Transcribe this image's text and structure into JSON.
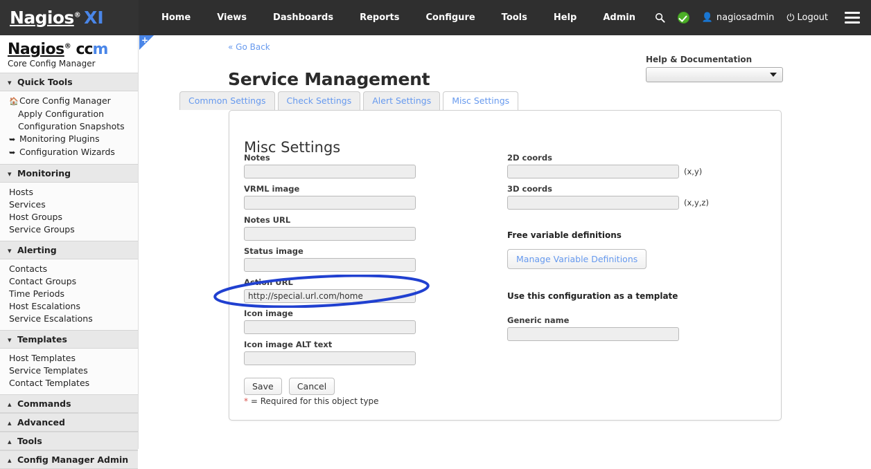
{
  "topbar": {
    "logo": {
      "name": "Nagios",
      "reg": "®",
      "product": "XI"
    },
    "nav": [
      {
        "label": "Home"
      },
      {
        "label": "Views"
      },
      {
        "label": "Dashboards"
      },
      {
        "label": "Reports"
      },
      {
        "label": "Configure"
      },
      {
        "label": "Tools"
      },
      {
        "label": "Help"
      },
      {
        "label": "Admin"
      }
    ],
    "right": {
      "search_icon": "search-icon",
      "status_icon": "green-check-icon",
      "user_icon": "person-icon",
      "username": "nagiosadmin",
      "power_icon": "power-icon",
      "logout": "Logout",
      "menu_icon": "hamburger-icon"
    }
  },
  "sidebar": {
    "brand": {
      "name": "Nagios",
      "reg": "®",
      "cc": "cc",
      "m": "m",
      "subtitle": "Core Config Manager"
    },
    "sections": [
      {
        "title": "Quick Tools",
        "collapsed": false,
        "chevron": "chevron-down-icon",
        "items": [
          {
            "label": "Core Config Manager",
            "icon": "home-icon"
          },
          {
            "label": "Apply Configuration",
            "icon": ""
          },
          {
            "label": "Configuration Snapshots",
            "icon": ""
          },
          {
            "label": "Monitoring Plugins",
            "icon": "arrow-right-icon"
          },
          {
            "label": "Configuration Wizards",
            "icon": "arrow-right-icon"
          }
        ]
      },
      {
        "title": "Monitoring",
        "collapsed": false,
        "chevron": "chevron-down-icon",
        "items": [
          {
            "label": "Hosts",
            "icon": ""
          },
          {
            "label": "Services",
            "icon": ""
          },
          {
            "label": "Host Groups",
            "icon": ""
          },
          {
            "label": "Service Groups",
            "icon": ""
          }
        ]
      },
      {
        "title": "Alerting",
        "collapsed": false,
        "chevron": "chevron-down-icon",
        "items": [
          {
            "label": "Contacts",
            "icon": ""
          },
          {
            "label": "Contact Groups",
            "icon": ""
          },
          {
            "label": "Time Periods",
            "icon": ""
          },
          {
            "label": "Host Escalations",
            "icon": ""
          },
          {
            "label": "Service Escalations",
            "icon": ""
          }
        ]
      },
      {
        "title": "Templates",
        "collapsed": false,
        "chevron": "chevron-down-icon",
        "items": [
          {
            "label": "Host Templates",
            "icon": ""
          },
          {
            "label": "Service Templates",
            "icon": ""
          },
          {
            "label": "Contact Templates",
            "icon": ""
          }
        ]
      },
      {
        "title": "Commands",
        "collapsed": true,
        "chevron": "chevron-up-icon",
        "items": []
      },
      {
        "title": "Advanced",
        "collapsed": true,
        "chevron": "chevron-up-icon",
        "items": []
      },
      {
        "title": "Tools",
        "collapsed": true,
        "chevron": "chevron-up-icon",
        "items": []
      },
      {
        "title": "Config Manager Admin",
        "collapsed": true,
        "chevron": "chevron-up-icon",
        "items": []
      }
    ]
  },
  "content": {
    "corner_toggle": {
      "icon": "plus-icon",
      "label": "+"
    },
    "go_back": "« Go Back",
    "page_title": "Service Management",
    "help": {
      "label": "Help & Documentation",
      "selected": "",
      "caret": "chevron-down-icon"
    },
    "tabs": [
      {
        "label": "Common Settings",
        "active": false
      },
      {
        "label": "Check Settings",
        "active": false
      },
      {
        "label": "Alert Settings",
        "active": false
      },
      {
        "label": "Misc Settings",
        "active": true
      }
    ],
    "card_title": "Misc Settings",
    "left_fields": [
      {
        "label": "Notes",
        "value": "",
        "name": "notes"
      },
      {
        "label": "VRML image",
        "value": "",
        "name": "vrml-image"
      },
      {
        "label": "Notes URL",
        "value": "",
        "name": "notes-url"
      },
      {
        "label": "Status image",
        "value": "",
        "name": "status-image"
      },
      {
        "label": "Action URL",
        "value": "http://special.url.com/home",
        "name": "action-url"
      },
      {
        "label": "Icon image",
        "value": "",
        "name": "icon-image"
      },
      {
        "label": "Icon image ALT text",
        "value": "",
        "name": "icon-image-alt-text"
      }
    ],
    "right": {
      "coord_2d": {
        "label": "2D coords",
        "value": "",
        "hint": "(x,y)"
      },
      "coord_3d": {
        "label": "3D coords",
        "value": "",
        "hint": "(x,y,z)"
      },
      "free_vars_heading": "Free variable definitions",
      "manage_vars_button": "Manage Variable Definitions",
      "template_heading": "Use this configuration as a template",
      "generic_name": {
        "label": "Generic name",
        "value": ""
      }
    },
    "save_button": "Save",
    "cancel_button": "Cancel",
    "required_star": "*",
    "required_note": "= Required for this object type"
  },
  "annotation": {
    "type": "ellipse-highlight",
    "target": "action-url-field",
    "color": "#2040d0"
  }
}
